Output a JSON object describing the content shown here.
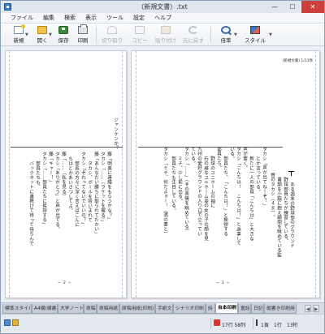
{
  "window": {
    "title": "（新規文書）.txt",
    "controls": {
      "minimize": "—",
      "maximize": "☐",
      "close": "✕"
    }
  },
  "menu": [
    "ファイル",
    "編集",
    "検索",
    "表示",
    "ツール",
    "設定",
    "ヘルプ"
  ],
  "toolbar": {
    "new": "新規",
    "open": "開く",
    "save": "保存",
    "print": "印刷",
    "cut": "切り取り",
    "copy": "コピー",
    "paste": "貼り付け",
    "undo": "元に戻す",
    "zoom": "倍率",
    "style": "スタイル"
  },
  "document": {
    "header_tag": "(新規文書) 1/13頁",
    "right_page_number": "− １ −",
    "left_page_number": "− ２ −",
    "right_page_columns": [
      "　ある週末の野球部のグラウンド",
      "　野球部員たちが練習している。",
      "　書類を小脇に抱え顧問を眺めている監",
      "督のタカシ（４８）。",
      "タカシ「声が出てねーぞ！」",
      "　とか言っている。",
      "　新たに一人の部員「こんちは」と大きな",
      "声が響く。",
      "タカシ「こんちは！　こんちは！」と返事して",
      "いる。",
      "　部員たち、「こんちは！」と挨拶する",
      "部員たち。",
      "　野球のユニホームの袖に",
      "　石の様なユニホーム姿の女の子の顔を見",
      "九州の愛好グラウンドの入り口で立ってい",
      "ている。",
      "タカシ「……」（その表情を眺めている）",
      "　ミチ、少し前に出る。",
      "　部員たちも注目している。",
      "タカシ「ミチ、何だよぉー！（満の妻と）"
    ],
    "left_page_columns": [
      "ジャンケンか？",
      "藤「明美に連絡をもらうかな？」",
      "タカシ「……（ラケットを握る）」",
      "藤「あんなだい勝ちに取られてたかい」",
      "　タカシ、ボールを拾いまれて",
      "タカシ「それってないでいいの？」",
      "　部長の方々に深く言えばこんに",
      "ちはとかあいさつしてよ。",
      "藤「……（私を見る）",
      "タカシ「ありがとう」と声が出でる。",
      "藤「キャー！」",
      "タカシ「……部員たちに挨拶する」",
      "　部員たちも、",
      "　バックネットに連携けて待って待ちんで"
    ]
  },
  "tabs": [
    {
      "label": "標準スタイル",
      "active": false
    },
    {
      "label": "A4横(横書き)",
      "active": false
    },
    {
      "label": "大学ノート",
      "active": false
    },
    {
      "label": "原稿",
      "active": false
    },
    {
      "label": "原稿用紙",
      "active": false
    },
    {
      "label": "原稿用紙(印刷)",
      "active": false
    },
    {
      "label": "手紙文",
      "active": false
    },
    {
      "label": "シナリオ印刷",
      "active": false
    },
    {
      "label": "詩",
      "active": false
    },
    {
      "label": "台本印刷",
      "active": true
    },
    {
      "label": "童話",
      "active": false
    },
    {
      "label": "日記",
      "active": false
    },
    {
      "label": "縦書き印刷用",
      "active": false
    }
  ],
  "status": {
    "chars": "17行 58列",
    "page": "1頁",
    "line": "1行",
    "total": "13桁"
  }
}
